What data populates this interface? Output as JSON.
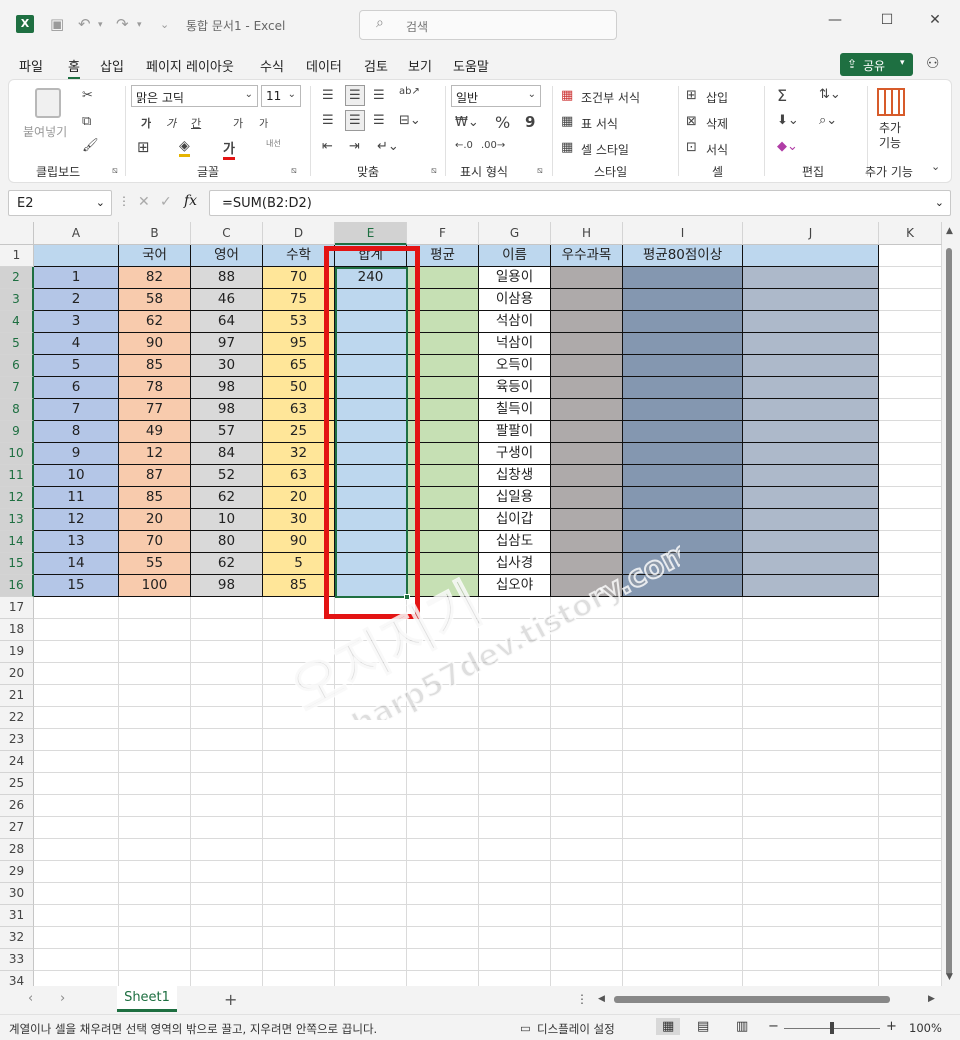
{
  "app": {
    "title": "통합 문서1  -  Excel",
    "search_placeholder": "검색",
    "share_label": "공유"
  },
  "menu": [
    "파일",
    "홈",
    "삽입",
    "페이지 레이아웃",
    "수식",
    "데이터",
    "검토",
    "보기",
    "도움말"
  ],
  "ribbon": {
    "clipboard": {
      "paste": "붙여넣기",
      "label": "클립보드"
    },
    "font": {
      "name": "맑은 고딕",
      "size": "11",
      "label": "글꼴",
      "bold": "가",
      "italic": "가",
      "underline": "간",
      "grow": "가",
      "shrink": "가",
      "color": "가",
      "phonetic": "내선"
    },
    "align": {
      "label": "맞춤"
    },
    "number": {
      "format": "일반",
      "label": "표시 형식",
      "percent": "%",
      "comma": "9"
    },
    "styles": {
      "cond": "조건부 서식",
      "table": "표 서식",
      "cell": "셀 스타일",
      "label": "스타일"
    },
    "cells": {
      "insert": "삽입",
      "delete": "삭제",
      "format": "서식",
      "label": "셀"
    },
    "edit": {
      "label": "편집",
      "sum": "Σ"
    },
    "addins": {
      "btn": "추가\n기능",
      "label": "추가 기능"
    }
  },
  "formula": {
    "name_box": "E2",
    "formula": "=SUM(B2:D2)",
    "fx": "fx"
  },
  "columns": [
    "A",
    "B",
    "C",
    "D",
    "E",
    "F",
    "G",
    "H",
    "I",
    "J",
    "K"
  ],
  "header_row": [
    "",
    "국어",
    "영어",
    "수학",
    "합계",
    "평균",
    "이름",
    "우수과목",
    "평균80점이상",
    ""
  ],
  "rows": [
    [
      "1",
      "82",
      "88",
      "70",
      "240",
      "",
      "일용이",
      "",
      "",
      ""
    ],
    [
      "2",
      "58",
      "46",
      "75",
      "",
      "",
      "이삼용",
      "",
      "",
      ""
    ],
    [
      "3",
      "62",
      "64",
      "53",
      "",
      "",
      "석삼이",
      "",
      "",
      ""
    ],
    [
      "4",
      "90",
      "97",
      "95",
      "",
      "",
      "넉삼이",
      "",
      "",
      ""
    ],
    [
      "5",
      "85",
      "30",
      "65",
      "",
      "",
      "오득이",
      "",
      "",
      ""
    ],
    [
      "6",
      "78",
      "98",
      "50",
      "",
      "",
      "육등이",
      "",
      "",
      ""
    ],
    [
      "7",
      "77",
      "98",
      "63",
      "",
      "",
      "칠득이",
      "",
      "",
      ""
    ],
    [
      "8",
      "49",
      "57",
      "25",
      "",
      "",
      "팔팔이",
      "",
      "",
      ""
    ],
    [
      "9",
      "12",
      "84",
      "32",
      "",
      "",
      "구생이",
      "",
      "",
      ""
    ],
    [
      "10",
      "87",
      "52",
      "63",
      "",
      "",
      "십창생",
      "",
      "",
      ""
    ],
    [
      "11",
      "85",
      "62",
      "20",
      "",
      "",
      "십일용",
      "",
      "",
      ""
    ],
    [
      "12",
      "20",
      "10",
      "30",
      "",
      "",
      "십이갑",
      "",
      "",
      ""
    ],
    [
      "13",
      "70",
      "80",
      "90",
      "",
      "",
      "십삼도",
      "",
      "",
      ""
    ],
    [
      "14",
      "55",
      "62",
      "5",
      "",
      "",
      "십사경",
      "",
      "",
      ""
    ],
    [
      "15",
      "100",
      "98",
      "85",
      "",
      "",
      "십오야",
      "",
      "",
      ""
    ]
  ],
  "row_numbers": [
    "1",
    "2",
    "3",
    "4",
    "5",
    "6",
    "7",
    "8",
    "9",
    "10",
    "11",
    "12",
    "13",
    "14",
    "15",
    "16",
    "17",
    "18",
    "19",
    "20",
    "21",
    "22",
    "23",
    "24",
    "25",
    "26",
    "27",
    "28",
    "29",
    "30",
    "31",
    "32",
    "33",
    "34"
  ],
  "col_colors": [
    "#b4c6e7",
    "#f8cbad",
    "#d9d9d9",
    "#ffe699",
    "#bdd7ee",
    "#c6e0b4",
    "#ffffff",
    "#aeaaaa",
    "#8497b0",
    "#adb9ca"
  ],
  "header_fill": "#bdd7ee",
  "sheet": {
    "tab": "Sheet1"
  },
  "status": {
    "message": "계열이나 셀을 채우려면 선택 영역의 밖으로 끌고, 지우려면 안쪽으로 끕니다.",
    "display": "디스플레이 설정",
    "zoom": "100%"
  },
  "watermark": {
    "text1": "오지지기",
    "text2": "sharp57dev.tistory.com"
  }
}
